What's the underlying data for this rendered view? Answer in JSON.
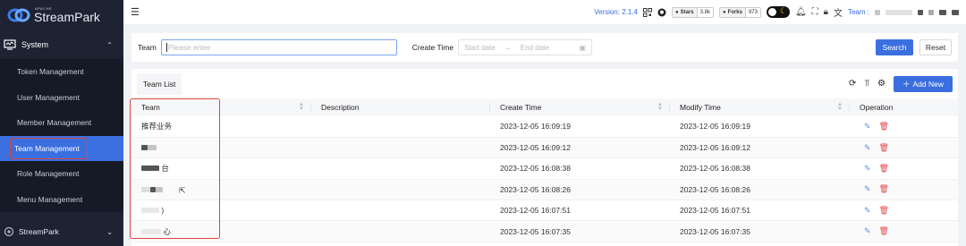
{
  "app": {
    "logo_small": "APACHE",
    "logo_big": "StreamPark"
  },
  "sidebar": {
    "group_system": "System",
    "items": [
      {
        "label": "Token Management"
      },
      {
        "label": "User Management"
      },
      {
        "label": "Member Management"
      },
      {
        "label": "Team Management"
      },
      {
        "label": "Role Management"
      },
      {
        "label": "Menu Management"
      }
    ],
    "group_streampark": "StreamPark"
  },
  "header": {
    "version": "Version: 2.1.4",
    "stars_label": "Stars",
    "stars_count": "3.8k",
    "forks_label": "Forks",
    "forks_count": "973",
    "team_label": "Team :"
  },
  "search": {
    "team_label": "Team",
    "team_placeholder": "Please enter",
    "create_time_label": "Create Time",
    "start_placeholder": "Start date",
    "end_placeholder": "End date",
    "search_button": "Search",
    "reset_button": "Reset"
  },
  "table": {
    "tab_label": "Team List",
    "add_button": "Add New",
    "columns": [
      "Team",
      "Description",
      "Create Time",
      "Modify Time",
      "Operation"
    ],
    "rows": [
      {
        "team": "推荐业务",
        "description": "",
        "create_time": "2023-12-05 16:09:19",
        "modify_time": "2023-12-05 16:09:19"
      },
      {
        "team": "",
        "description": "",
        "create_time": "2023-12-05 16:09:12",
        "modify_time": "2023-12-05 16:09:12"
      },
      {
        "team": "台",
        "description": "",
        "create_time": "2023-12-05 16:08:38",
        "modify_time": "2023-12-05 16:08:38"
      },
      {
        "team": "",
        "description": "",
        "create_time": "2023-12-05 16:08:26",
        "modify_time": "2023-12-05 16:08:26"
      },
      {
        "team": ")",
        "description": "",
        "create_time": "2023-12-05 16:07:51",
        "modify_time": "2023-12-05 16:07:51"
      },
      {
        "team": "心",
        "description": "",
        "create_time": "2023-12-05 16:07:35",
        "modify_time": "2023-12-05 16:07:35"
      }
    ]
  },
  "colors": {
    "primary": "#3b6fe0",
    "sidebar_bg": "#1d2333",
    "highlight_box": "#e0463a",
    "delete": "#e5484d"
  },
  "icons": [
    "menu-icon",
    "monitor-icon",
    "chevron-up-icon",
    "chevron-down-icon",
    "qrcode-icon",
    "github-icon",
    "bell-icon",
    "fullscreen-icon",
    "lock-icon",
    "translate-icon",
    "refresh-icon",
    "column-height-icon",
    "settings-icon",
    "plus-icon",
    "edit-icon",
    "delete-icon",
    "calendar-icon"
  ]
}
